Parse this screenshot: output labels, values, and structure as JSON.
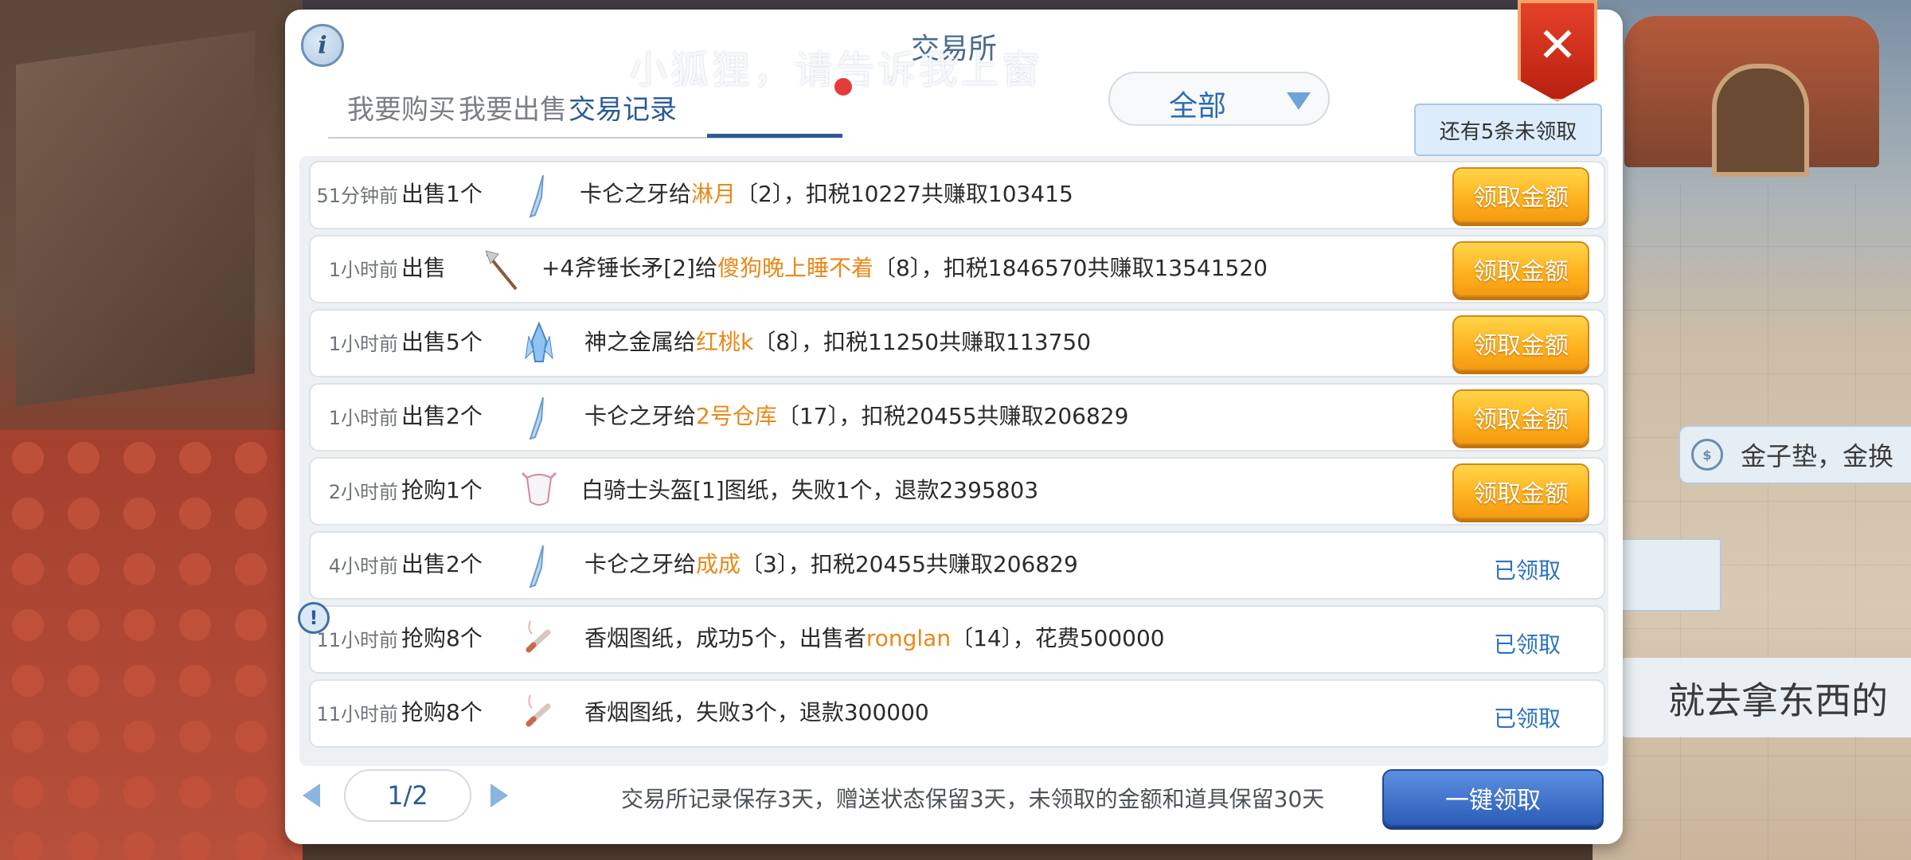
{
  "dialog": {
    "title": "交易所",
    "ghost_text": "小狐狸，请告诉我上窗",
    "tabs": [
      {
        "label": "我要购买"
      },
      {
        "label": "我要出售"
      },
      {
        "label": "交易记录"
      }
    ],
    "filter": {
      "selected": "全部"
    },
    "notice": "还有5条未领取",
    "claim_label": "领取金额",
    "claimed_label": "已领取",
    "records": [
      {
        "time": "51分钟前",
        "action": "出售1个",
        "icon": "crystal-fang-icon",
        "pre": "卡仑之牙给",
        "name": "淋月",
        "post": "〔2〕，扣税10227共赚取103415",
        "status": "claim"
      },
      {
        "time": "1小时前",
        "action": "出售",
        "icon": "halberd-icon",
        "pre": "+4斧锤长矛[2]给",
        "name": "傻狗晚上睡不着",
        "post": "〔8〕，扣税1846570共赚取13541520",
        "status": "claim"
      },
      {
        "time": "1小时前",
        "action": "出售5个",
        "icon": "divine-metal-icon",
        "pre": "神之金属给",
        "name": "红桃k",
        "post": "〔8〕，扣税11250共赚取113750",
        "status": "claim"
      },
      {
        "time": "1小时前",
        "action": "出售2个",
        "icon": "crystal-fang-icon",
        "pre": "卡仑之牙给",
        "name": "2号仓库",
        "post": "〔17〕，扣税20455共赚取206829",
        "status": "claim"
      },
      {
        "time": "2小时前",
        "action": "抢购1个",
        "icon": "knight-helmet-icon",
        "pre": "白骑士头盔[1]图纸，失败1个，退款2395803",
        "name": "",
        "post": "",
        "status": "claim"
      },
      {
        "time": "4小时前",
        "action": "出售2个",
        "icon": "crystal-fang-icon",
        "pre": "卡仑之牙给",
        "name": "成成",
        "post": "〔3〕，扣税20455共赚取206829",
        "status": "claimed"
      },
      {
        "time": "11小时前",
        "action": "抢购8个",
        "icon": "cigarette-icon",
        "pre": "香烟图纸，成功5个，出售者",
        "name": "ronglan",
        "post": "〔14〕，花费500000",
        "status": "claimed"
      },
      {
        "time": "11小时前",
        "action": "抢购8个",
        "icon": "cigarette-icon",
        "pre": "香烟图纸，失败3个，退款300000",
        "name": "",
        "post": "",
        "status": "claimed"
      }
    ],
    "pagination": {
      "current": "1/2"
    },
    "footer_note": "交易所记录保存3天，赠送状态保留3天，未领取的金额和道具保留30天",
    "claim_all_label": "一键领取"
  },
  "background": {
    "bubble_text": "金子垫，金换",
    "banner_text": "就去拿东西的",
    "banner_overlay": "就去拿东西"
  },
  "colors": {
    "accent_blue": "#2c5b98",
    "highlight_orange": "#e8891a",
    "claim_button": "#ffb31f",
    "close_red": "#d7301c"
  }
}
